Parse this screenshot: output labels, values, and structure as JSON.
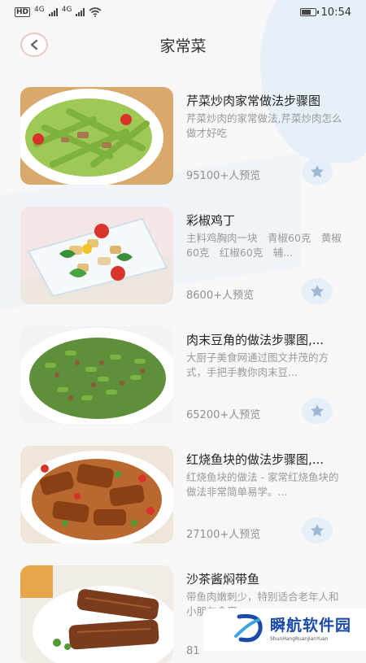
{
  "status_bar": {
    "left_text": "HD",
    "signal1_label": "4G",
    "signal2_label": "4G",
    "time": "10:54"
  },
  "header": {
    "back_icon": "chevron-left-icon",
    "title": "家常菜"
  },
  "recipes": [
    {
      "title": "芹菜炒肉家常做法步骤图",
      "desc": "芹菜炒肉的家常做法,芹菜炒肉怎么做才好吃",
      "views": "95100+人预览",
      "image": "celery-stir-fry"
    },
    {
      "title": "彩椒鸡丁",
      "desc": "主料鸡胸肉一块　青椒60克　黄椒60克　红椒60克　辅...",
      "views": "8600+人预览",
      "image": "pepper-chicken"
    },
    {
      "title": "肉末豆角的做法步骤图,...",
      "desc": "大厨子美食网通过图文并茂的方式，手把手教你肉末豆...",
      "views": "65200+人预览",
      "image": "minced-pork-beans"
    },
    {
      "title": "红烧鱼块的做法步骤图,...",
      "desc": "红烧鱼块的做法 - 家常红烧鱼块的做法非常简单易学。...",
      "views": "27100+人预览",
      "image": "braised-fish"
    },
    {
      "title": "沙茶酱焖带鱼",
      "desc": "带鱼肉嫩刺少，特别适合老年人和小朋友食用",
      "views": "81",
      "image": "braised-hairtail"
    }
  ],
  "watermark": {
    "main": "瞬航软件园",
    "sub": "ShunHangRuanJianYuan"
  },
  "colors": {
    "accent_star": "#9fb8d6",
    "fav_bg": "#e6eef7",
    "title_text": "#222222",
    "muted_text": "#9a9a9a"
  }
}
